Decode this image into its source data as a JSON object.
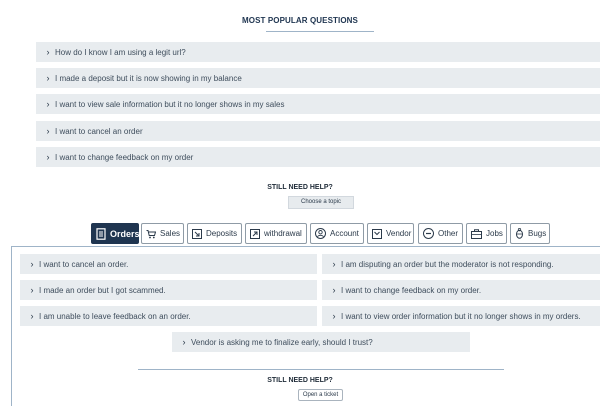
{
  "popular": {
    "title": "MOST POPULAR QUESTIONS",
    "items": [
      "How do I know I am using a legit url?",
      "I made a deposit but it is now showing in my balance",
      "I want to view sale information but it no longer shows in my sales",
      "I want to cancel an order",
      "I want to change feedback on my order"
    ]
  },
  "help1": {
    "title": "STILL NEED HELP?",
    "button": "Choose a topic"
  },
  "tabs": [
    {
      "label": "Orders",
      "icon": "document-icon",
      "active": true
    },
    {
      "label": "Sales",
      "icon": "cart-icon"
    },
    {
      "label": "Deposits",
      "icon": "deposit-icon"
    },
    {
      "label": "withdrawal",
      "icon": "withdrawal-icon"
    },
    {
      "label": "Account",
      "icon": "user-icon"
    },
    {
      "label": "Vendor",
      "icon": "vendor-icon"
    },
    {
      "label": "Other",
      "icon": "more-icon"
    },
    {
      "label": "Jobs",
      "icon": "briefcase-icon"
    },
    {
      "label": "Bugs",
      "icon": "bug-icon"
    }
  ],
  "orders": {
    "left": [
      "I want to cancel an order.",
      "I made an order but I got scammed.",
      "I am unable to leave feedback on an order."
    ],
    "right": [
      "I am disputing an order but the moderator is not responding.",
      "I want to change feedback on my order.",
      "I want to view order information but it no longer shows in my orders."
    ],
    "center": "Vendor is asking me to finalize early, should I trust?"
  },
  "help2": {
    "title": "STILL NEED HELP?",
    "button": "Open a ticket"
  }
}
